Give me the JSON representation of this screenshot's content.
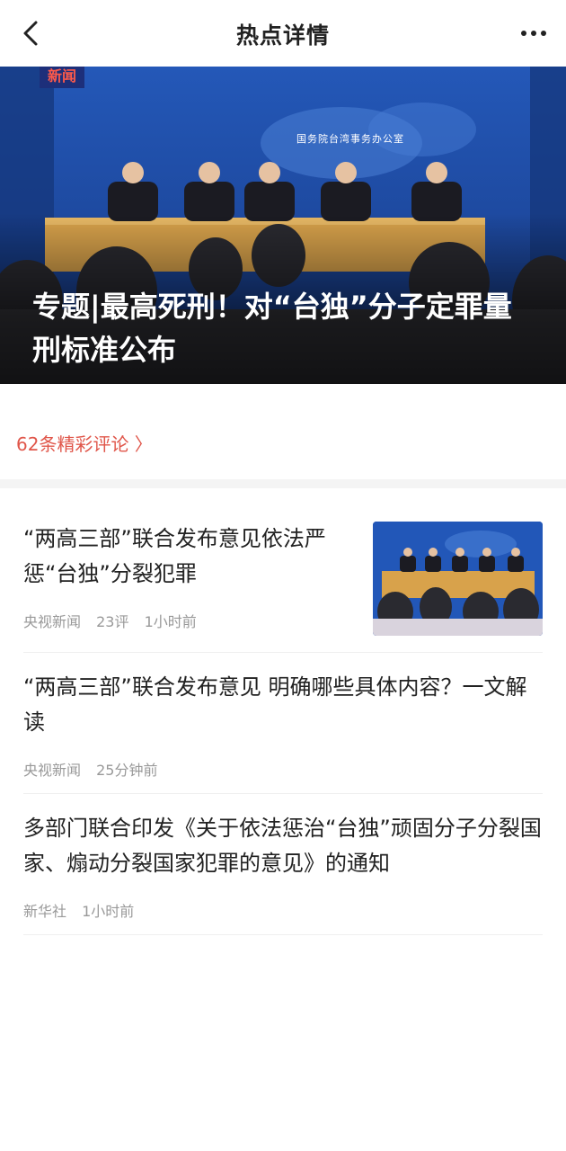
{
  "header": {
    "title": "热点详情"
  },
  "hero": {
    "badge": "新闻",
    "seal_text": "国务院台湾事务办公室",
    "headline": "专题|最高死刑！对“台独”分子定罪量刑标准公布"
  },
  "comments_link": "62条精彩评论 〉",
  "news": [
    {
      "title": "“两高三部”联合发布意见依法严惩“台独”分裂犯罪",
      "source": "央视新闻",
      "comments": "23评",
      "time": "1小时前",
      "has_thumbnail": true
    },
    {
      "title": "“两高三部”联合发布意见 明确哪些具体内容？一文解读",
      "source": "央视新闻",
      "time": "25分钟前",
      "has_thumbnail": false
    },
    {
      "title": "多部门联合印发《关于依法惩治“台独”顽固分子分裂国家、煽动分裂国家犯罪的意见》的通知",
      "source": "新华社",
      "time": "1小时前",
      "has_thumbnail": false
    }
  ],
  "icons": {
    "back": "chevron-left-icon",
    "more": "more-dots-icon"
  },
  "colors": {
    "accent": "#e0564a",
    "meta": "#999999",
    "hero_bg": "#1c3f8f"
  }
}
